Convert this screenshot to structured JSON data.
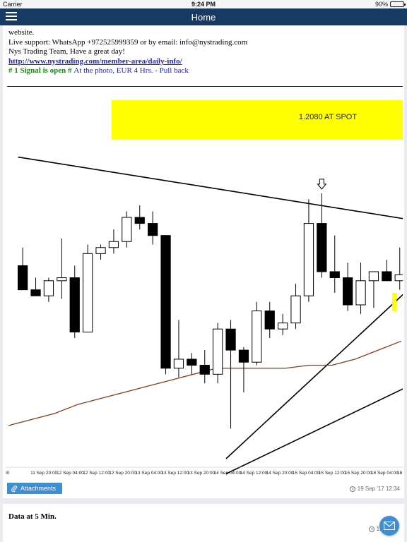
{
  "status_bar": {
    "carrier": "Carrier",
    "time": "9:24 PM",
    "battery": "90%",
    "battery_level": 0.9
  },
  "nav": {
    "title": "Home",
    "menu_icon": "hamburger-menu-icon"
  },
  "post": {
    "line_website": "website.",
    "line_support": "Live support: WhatsApp +972525999359 or by email: info@nystrading.com",
    "line_team": "Nys Trading Team, Have a great day!",
    "link": "http://www.nystrading.com/member-area/daily-info/",
    "signal_strong": " # 1 Signal is open # ",
    "signal_rest": "At the photo, EUR 4 Hrs. - Pull back",
    "attachments_label": "Attachments",
    "timestamp": "19 Sep '17 12:34"
  },
  "chart_data": {
    "type": "candlestick",
    "annotation": "1.2080 AT SPOT",
    "annotation_color": "#ffff00",
    "x_tick_labels": [
      "00",
      "11 Sep 20:00",
      "12 Sep 04:00",
      "12 Sep 12:00",
      "12 Sep 20:00",
      "13 Sep 04:00",
      "13 Sep 12:00",
      "13 Sep 20:00",
      "14 Sep 04:00",
      "14 Sep 12:00",
      "14 Sep 20:00",
      "15 Sep 04:00",
      "15 Sep 12:00",
      "15 Sep 20:00",
      "18 Sep 04:00",
      "18"
    ],
    "candles": [
      {
        "o": 5.4,
        "h": 6.0,
        "l": 4.9,
        "c": 4.6
      },
      {
        "o": 4.6,
        "h": 5.0,
        "l": 4.4,
        "c": 4.4
      },
      {
        "o": 4.4,
        "h": 5.0,
        "l": 4.2,
        "c": 4.9
      },
      {
        "o": 4.9,
        "h": 6.3,
        "l": 4.3,
        "c": 5.0
      },
      {
        "o": 5.0,
        "h": 5.4,
        "l": 3.0,
        "c": 3.2
      },
      {
        "o": 3.2,
        "h": 6.1,
        "l": 3.2,
        "c": 5.8
      },
      {
        "o": 5.8,
        "h": 6.1,
        "l": 5.6,
        "c": 6.0
      },
      {
        "o": 6.0,
        "h": 6.6,
        "l": 5.8,
        "c": 6.2
      },
      {
        "o": 6.2,
        "h": 7.2,
        "l": 6.0,
        "c": 7.0
      },
      {
        "o": 7.0,
        "h": 7.4,
        "l": 6.6,
        "c": 6.8
      },
      {
        "o": 6.8,
        "h": 7.2,
        "l": 6.1,
        "c": 6.4
      },
      {
        "o": 6.4,
        "h": 6.4,
        "l": 1.8,
        "c": 2.0
      },
      {
        "o": 2.0,
        "h": 3.6,
        "l": 1.7,
        "c": 2.3
      },
      {
        "o": 2.3,
        "h": 2.5,
        "l": 1.8,
        "c": 2.1
      },
      {
        "o": 2.1,
        "h": 2.6,
        "l": 1.5,
        "c": 1.8
      },
      {
        "o": 1.8,
        "h": 3.5,
        "l": 1.5,
        "c": 3.3
      },
      {
        "o": 3.3,
        "h": 3.6,
        "l": 0.0,
        "c": 2.6
      },
      {
        "o": 2.6,
        "h": 2.7,
        "l": 1.2,
        "c": 2.2
      },
      {
        "o": 2.2,
        "h": 4.2,
        "l": 2.1,
        "c": 3.9
      },
      {
        "o": 3.9,
        "h": 4.2,
        "l": 3.0,
        "c": 3.3
      },
      {
        "o": 3.3,
        "h": 3.8,
        "l": 3.1,
        "c": 3.5
      },
      {
        "o": 3.5,
        "h": 4.8,
        "l": 3.3,
        "c": 4.4
      },
      {
        "o": 4.4,
        "h": 7.6,
        "l": 4.2,
        "c": 6.8
      },
      {
        "o": 6.8,
        "h": 7.8,
        "l": 5.0,
        "c": 5.2
      },
      {
        "o": 5.2,
        "h": 6.4,
        "l": 4.5,
        "c": 5.0
      },
      {
        "o": 5.0,
        "h": 5.5,
        "l": 3.9,
        "c": 4.1
      },
      {
        "o": 4.1,
        "h": 5.5,
        "l": 3.8,
        "c": 4.9
      },
      {
        "o": 4.9,
        "h": 5.2,
        "l": 4.0,
        "c": 5.2
      },
      {
        "o": 5.2,
        "h": 5.6,
        "l": 4.9,
        "c": 4.9
      },
      {
        "o": 4.9,
        "h": 6.0,
        "l": 4.6,
        "c": 5.1
      }
    ],
    "moving_average": [
      0.1,
      0.3,
      0.5,
      0.8,
      1.0,
      1.2,
      1.4,
      1.6,
      1.8,
      2.0,
      2.0,
      2.0,
      2.0,
      2.1,
      2.1,
      2.3,
      2.6,
      2.9
    ],
    "trendline_down": [
      [
        0,
        9.0
      ],
      [
        30.5,
        6.9
      ]
    ],
    "trendline_up_1": [
      [
        16.0,
        -1.0
      ],
      [
        30.5,
        4.8
      ]
    ],
    "trendline_up_2": [
      [
        16.0,
        -1.5
      ],
      [
        30.5,
        1.5
      ]
    ],
    "arrow_candle_index": 23,
    "up_color": "#ffffff",
    "down_color": "#000000",
    "ma_color": "#8a3a14"
  },
  "second_post": {
    "title": "Data at 5 Min.",
    "timestamp_partial": "19 Sep"
  },
  "fab": {
    "icon": "mail-icon"
  }
}
